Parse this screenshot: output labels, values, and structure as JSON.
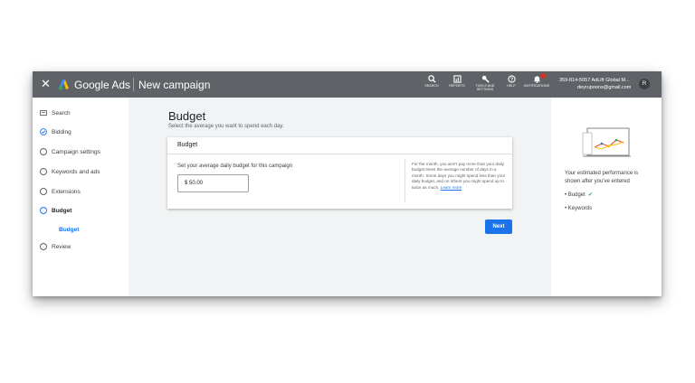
{
  "header": {
    "close_glyph": "✕",
    "brand": "Google Ads",
    "title": "New campaign",
    "tools": [
      {
        "icon": "search-icon",
        "label": "SEARCH"
      },
      {
        "icon": "reports-icon",
        "label": "REPORTS"
      },
      {
        "icon": "wrench-icon",
        "label": "TOOLS AND SETTINGS"
      },
      {
        "icon": "help-icon",
        "label": "HELP"
      },
      {
        "icon": "bell-icon",
        "label": "NOTIFICATIONS"
      }
    ],
    "account_id": "359-814-5057 AdLift Global M...",
    "account_email": "deyrupoons@gmail.com",
    "avatar_letter": "R"
  },
  "sidebar": {
    "items": [
      {
        "label": "Search",
        "icon": "search-image-icon"
      },
      {
        "label": "Bidding",
        "icon": "done-check-circle-icon"
      },
      {
        "label": "Campaign settings",
        "icon": "circle-icon"
      },
      {
        "label": "Keywords and ads",
        "icon": "circle-icon"
      },
      {
        "label": "Extensions",
        "icon": "circle-icon"
      },
      {
        "label": "Budget",
        "icon": "current-circle-icon"
      },
      {
        "label": "Budget",
        "icon": ""
      },
      {
        "label": "Review",
        "icon": "circle-icon"
      }
    ]
  },
  "main": {
    "title": "Budget",
    "subtitle": "Select the average you want to spend each day.",
    "card": {
      "header": "Budget",
      "field_label": "Set your average daily budget for this campaign",
      "budget_value": "$ 50.00",
      "info_text": "For the month, you won't pay more than your daily budget times the average number of days in a month. Some days you might spend less than your daily budget, and on others you might spend up to twice as much.",
      "learn_more": "Learn more"
    },
    "next_label": "Next"
  },
  "right_panel": {
    "estimate_text": "Your estimated performance is shown after you've entered",
    "bullets": [
      {
        "label": "Budget",
        "done": "✓"
      },
      {
        "label": "Keywords",
        "done": ""
      }
    ]
  },
  "colors": {
    "header_bg": "#5f6368",
    "accent": "#1a73e8",
    "success": "#1e8e3e"
  }
}
